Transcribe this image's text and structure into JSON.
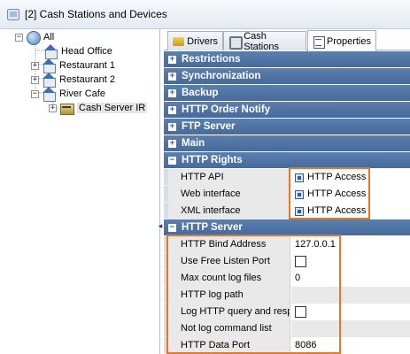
{
  "window": {
    "title": "[2] Cash Stations and Devices"
  },
  "tree": {
    "nodes": [
      {
        "label": "All",
        "icon": "globe-icon",
        "expander": "−"
      },
      {
        "label": "Head Office",
        "icon": "house-icon",
        "expander": ""
      },
      {
        "label": "Restaurant 1",
        "icon": "house-icon",
        "expander": "+"
      },
      {
        "label": "Restaurant 2",
        "icon": "house-icon",
        "expander": "+"
      },
      {
        "label": "River Cafe",
        "icon": "house-icon",
        "expander": "−"
      },
      {
        "label": "Cash Server IR",
        "icon": "cash-server-icon",
        "expander": "+"
      }
    ]
  },
  "tabs": [
    {
      "label": "Drivers",
      "icon": "drivers-icon"
    },
    {
      "label": "Cash Stations",
      "icon": "cash-stations-icon"
    },
    {
      "label": "Properties",
      "icon": "properties-icon"
    }
  ],
  "categories": {
    "restrictions": "Restrictions",
    "synchronization": "Synchronization",
    "backup": "Backup",
    "http_order_notify": "HTTP Order Notify",
    "ftp_server": "FTP Server",
    "main": "Main",
    "http_rights": "HTTP Rights",
    "http_server": "HTTP Server"
  },
  "expander_symbols": {
    "collapsed": "+",
    "expanded": "−",
    "splitter": "◂"
  },
  "http_rights": [
    {
      "name": "HTTP API",
      "value": "HTTP Access"
    },
    {
      "name": "Web interface",
      "value": "HTTP Access"
    },
    {
      "name": "XML interface",
      "value": "HTTP Access"
    }
  ],
  "http_server": {
    "bind_address": {
      "name": "HTTP Bind Address",
      "value": "127.0.0.1"
    },
    "use_free_listen_port": {
      "name": "Use Free Listen Port",
      "checked": false
    },
    "max_count_log_files": {
      "name": "Max count log files",
      "value": "0"
    },
    "log_path": {
      "name": "HTTP log path",
      "value": ""
    },
    "log_http_query": {
      "name": "Log HTTP query and resp",
      "checked": false
    },
    "not_log_command_list": {
      "name": "Not log command list",
      "value": ""
    },
    "data_port": {
      "name": "HTTP Data Port",
      "value": "8086"
    }
  },
  "colors": {
    "category_header": "#4f74a5",
    "highlight": "#e87722",
    "name_cell_bg": "#e9e9e9"
  }
}
